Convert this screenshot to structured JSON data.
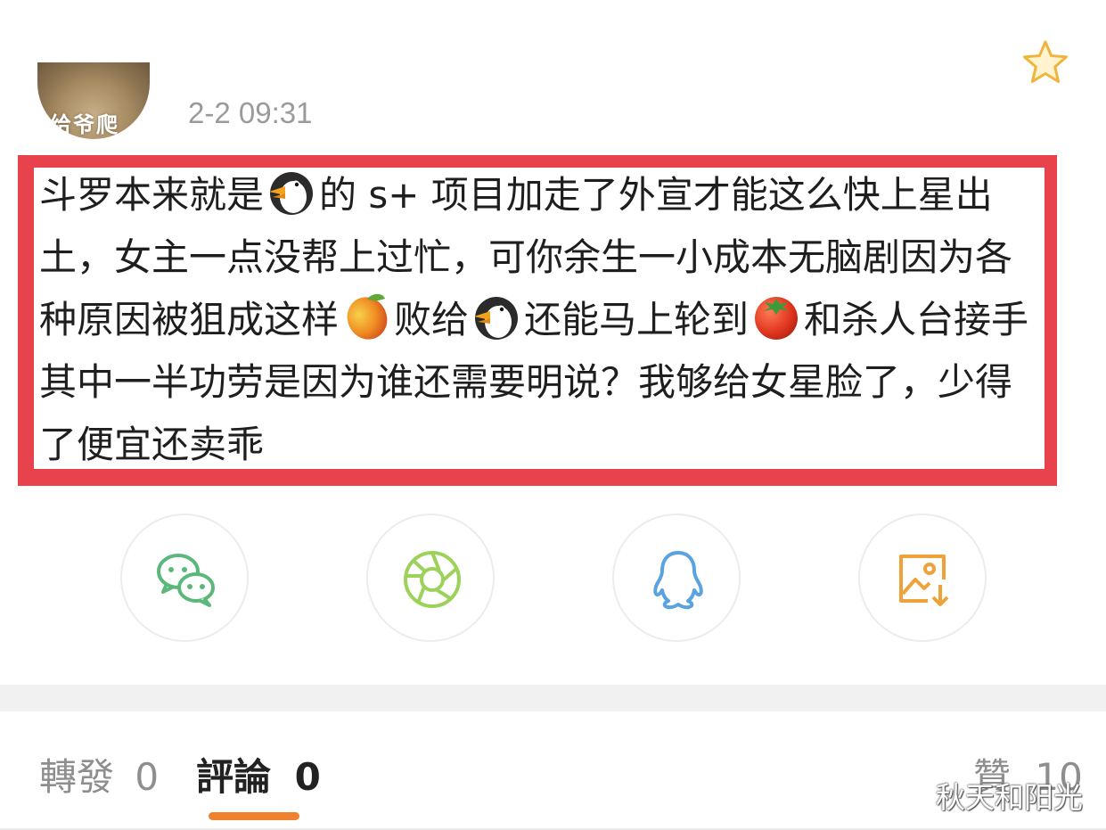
{
  "post": {
    "avatar_text": "给爷爬",
    "timestamp": "2-2 09:31",
    "text_segments": [
      {
        "type": "text",
        "value": "斗罗本来就是"
      },
      {
        "type": "emoji",
        "icon": "penguin-emoji"
      },
      {
        "type": "text",
        "value": "的 s+ 项目加走了外宣才能这么快上星出土，女主一点没帮上过忙，可你余生一小成本无脑剧因为各种原因被狙成这样"
      },
      {
        "type": "emoji",
        "icon": "mango-emoji"
      },
      {
        "type": "text",
        "value": "败给"
      },
      {
        "type": "emoji",
        "icon": "penguin-emoji"
      },
      {
        "type": "text",
        "value": "还能马上轮到"
      },
      {
        "type": "emoji",
        "icon": "tomato-emoji"
      },
      {
        "type": "text",
        "value": "和杀人台接手其中一半功劳是因为谁还需要明说？我够给女星脸了，少得了便宜还卖乖"
      }
    ]
  },
  "share": [
    {
      "icon": "wechat-icon",
      "color": "#5cb87a"
    },
    {
      "icon": "moments-aperture-icon",
      "color": "#9cd15a"
    },
    {
      "icon": "qq-penguin-icon",
      "color": "#5aa3e0"
    },
    {
      "icon": "save-image-icon",
      "color": "#f0a23a"
    }
  ],
  "tabs": {
    "repost_label": "轉發",
    "repost_count": "0",
    "comment_label": "評論",
    "comment_count": "0",
    "like_label": "贊",
    "like_count": "10"
  },
  "watermark": "秋天和阳光",
  "colors": {
    "highlight_frame": "#e8434c",
    "tab_indicator": "#f0822f"
  }
}
